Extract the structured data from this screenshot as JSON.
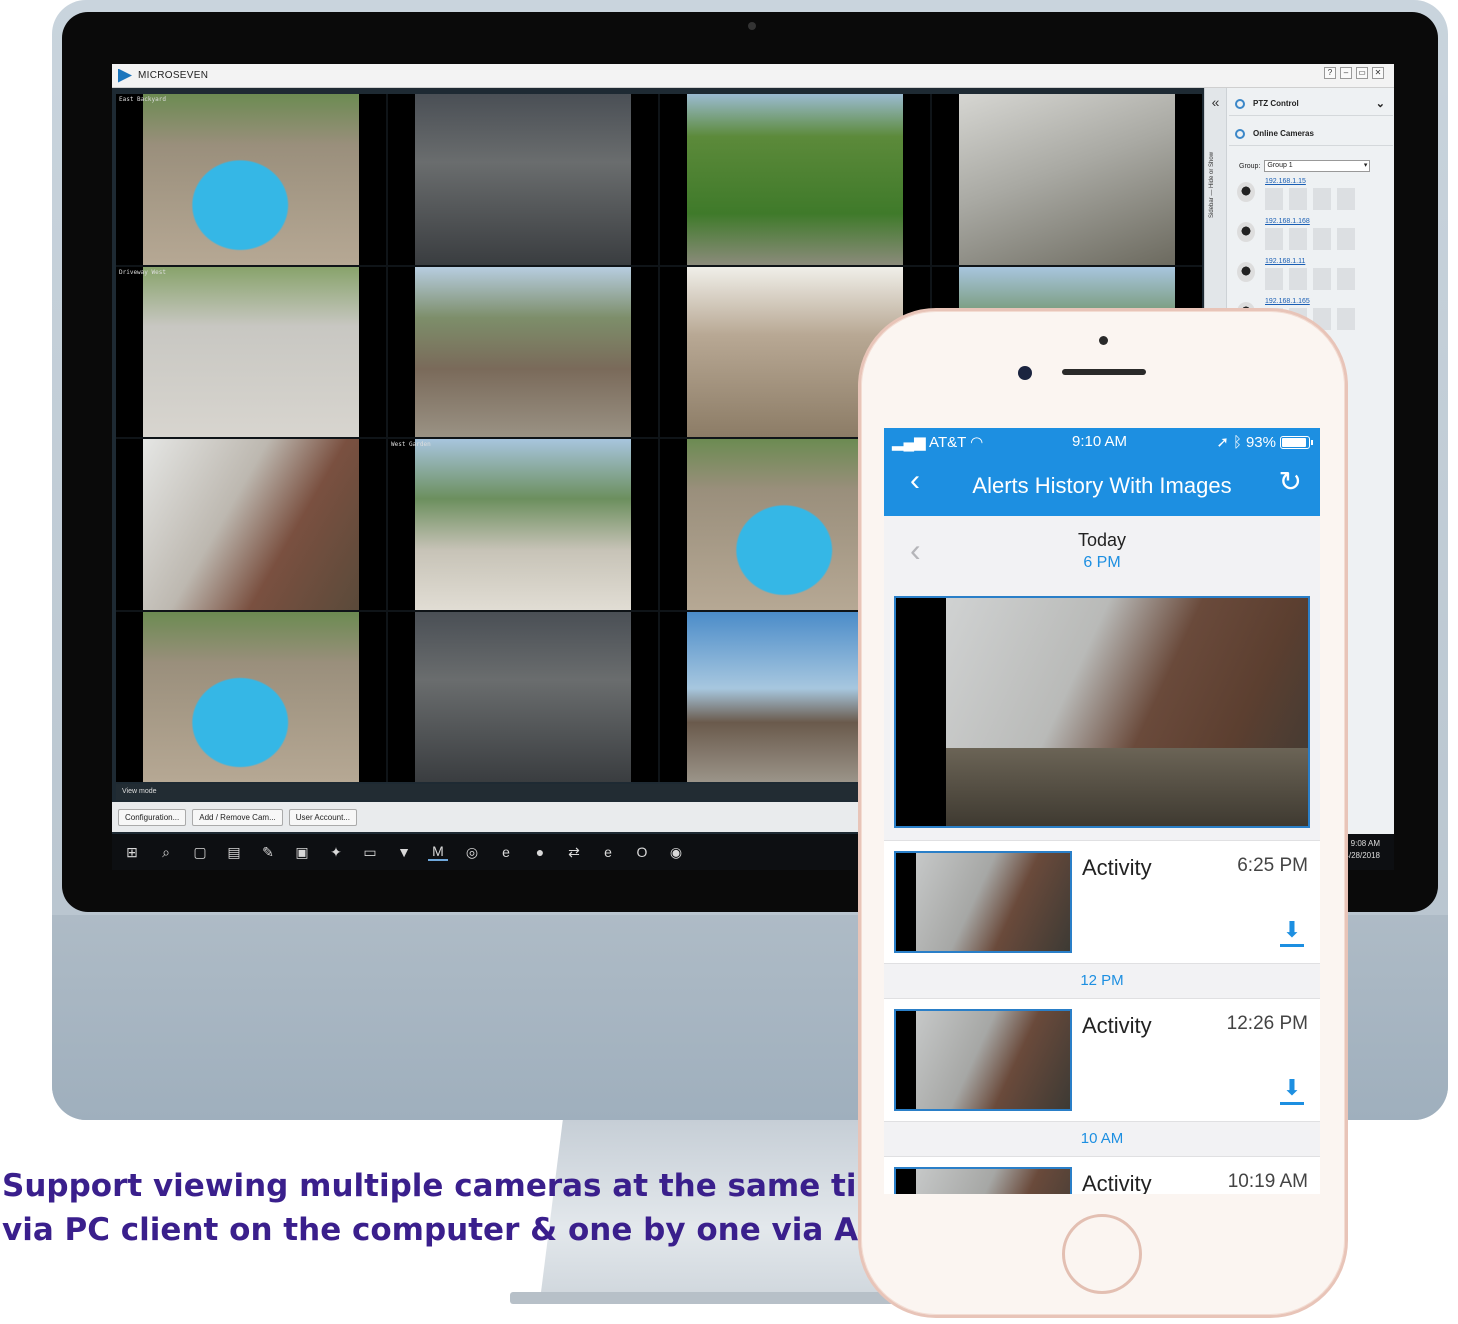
{
  "desktop": {
    "app_title": "MICROSEVEN",
    "window_controls": [
      "?",
      "–",
      "▭",
      "✕"
    ],
    "tiles": [
      {
        "label": "East Backyard",
        "scene": "pool"
      },
      {
        "label": "",
        "scene": "garage"
      },
      {
        "label": "",
        "scene": "lawn"
      },
      {
        "label": "",
        "scene": "wall"
      },
      {
        "label": "Driveway West",
        "scene": "drive"
      },
      {
        "label": "",
        "scene": "deck"
      },
      {
        "label": "",
        "scene": "patio"
      },
      {
        "label": "",
        "scene": "yard"
      },
      {
        "label": "",
        "scene": "door"
      },
      {
        "label": "West Garden",
        "scene": "yard"
      },
      {
        "label": "",
        "scene": "pool"
      },
      {
        "label": "",
        "scene": "sky"
      },
      {
        "label": "",
        "scene": "pool"
      },
      {
        "label": "",
        "scene": "garage"
      },
      {
        "label": "",
        "scene": "sky"
      },
      {
        "label": "",
        "scene": "yard"
      }
    ],
    "view_mode_label": "View mode",
    "toolbar": {
      "configuration": "Configuration...",
      "add_remove": "Add / Remove Cam...",
      "user_account": "User Account..."
    },
    "sidebar": {
      "ptz_control": "PTZ Control",
      "online_cameras": "Online Cameras",
      "group_label": "Group:",
      "group_value": "Group 1",
      "vertical_text": "Sidebar — Hide or Show",
      "cameras": [
        "192.168.1.15",
        "192.168.1.168",
        "192.168.1.11",
        "192.168.1.165"
      ]
    },
    "clock": {
      "time": "9:08 AM",
      "date": "4/28/2018"
    }
  },
  "phone": {
    "status": {
      "carrier": "AT&T",
      "time": "9:10 AM",
      "battery": "93%",
      "battery_level": 0.93
    },
    "nav_title": "Alerts History With Images",
    "date_day": "Today",
    "date_hour": "6 PM",
    "alerts": [
      {
        "type": "Activity",
        "time": "6:25 PM"
      },
      {
        "type": "Activity",
        "time": "12:26 PM"
      },
      {
        "type": "Activity",
        "time": "10:19 AM"
      }
    ],
    "sections": [
      "12 PM",
      "10 AM"
    ]
  },
  "caption": {
    "line1": "Support viewing multiple cameras at the same time",
    "line2": "via PC client on the computer & one by one via APP on the phone"
  },
  "colors": {
    "accent": "#1d8fe1",
    "caption": "#3a1f8c"
  }
}
